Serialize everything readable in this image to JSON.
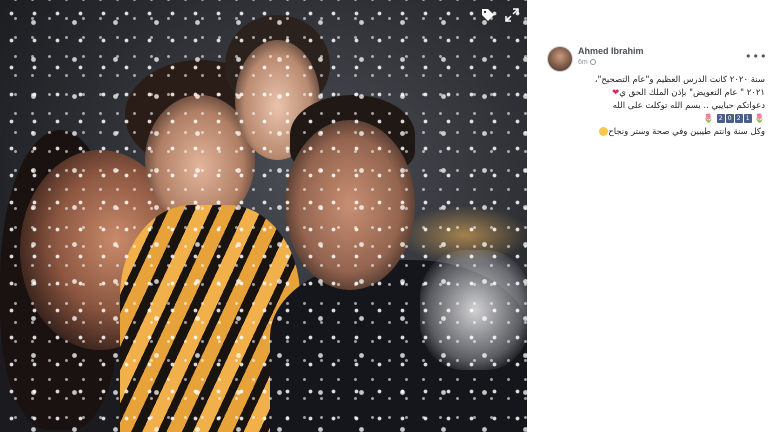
{
  "photo": {
    "description_icons": [
      "tag-icon",
      "expand-icon"
    ]
  },
  "post": {
    "author": "Ahmed Ibrahim",
    "timestamp": "6m",
    "more_label": "•••",
    "lines": [
      "سنة ٢٠٢٠ كانت الدرس العظيم و\"عام التصحيح\"،",
      "٢٠٢١ \" عام التعويض\" بإذن الملك الحق ي",
      "دعواتكم حبايبي .. بسم الله توكلت على الله",
      "وكل سنة وانتم طيبين وفي صحة وستر ونجاح"
    ],
    "heart": "❤",
    "year_digits": [
      "2",
      "0",
      "2",
      "1"
    ],
    "tulip": "🌷"
  },
  "colors": {
    "author": "#4b4f56",
    "meta": "#90949c",
    "text": "#1c1e21"
  }
}
